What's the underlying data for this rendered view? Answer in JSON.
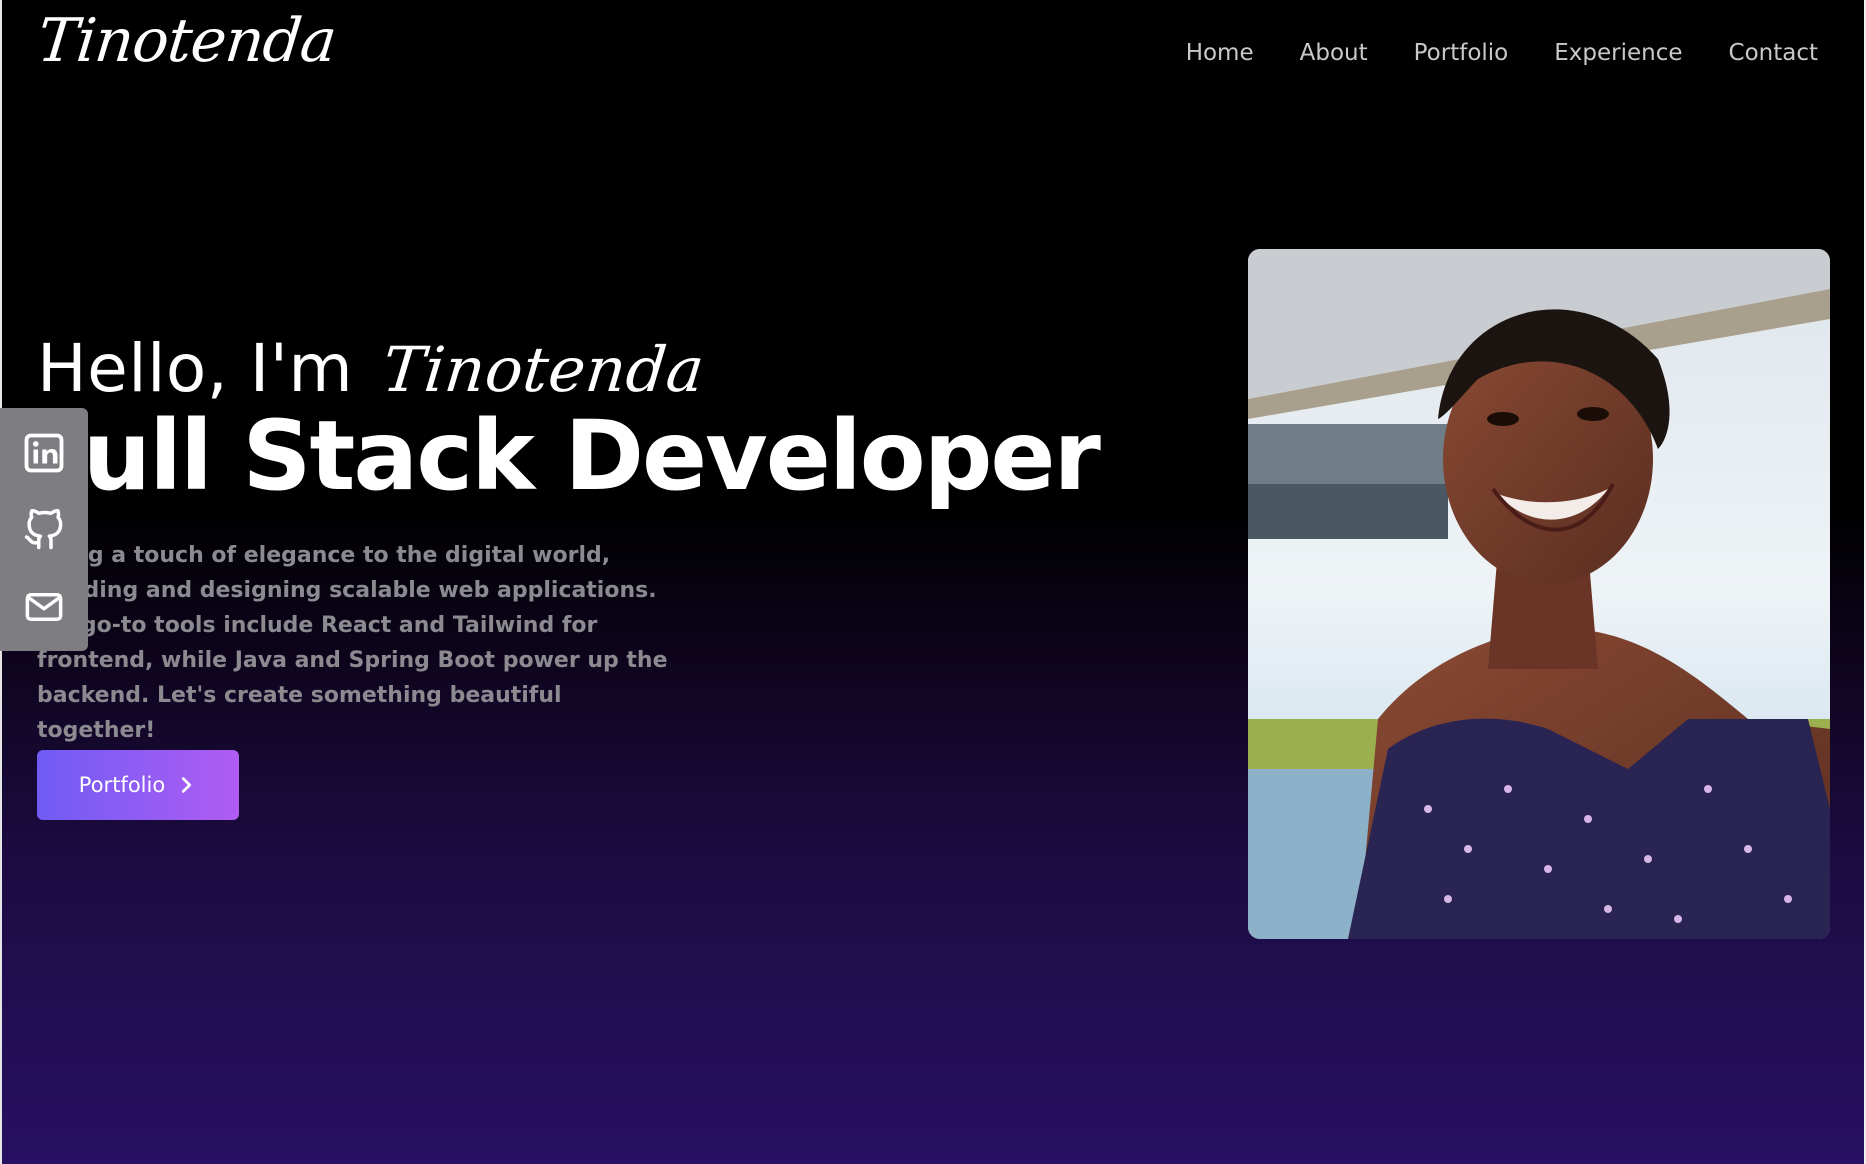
{
  "header": {
    "logo": "Tinotenda",
    "nav": [
      "Home",
      "About",
      "Portfolio",
      "Experience",
      "Contact"
    ]
  },
  "hero": {
    "greeting": "Hello, I'm",
    "name": "Tinotenda",
    "role": "Full Stack Developer",
    "description": "Bring a touch of elegance to the digital world, building and designing scalable web applications. My go-to tools include React and Tailwind for frontend, while Java and Spring Boot power up the backend. Let's create something beautiful together!",
    "button_label": "Portfolio",
    "button_icon": "chevron-right-icon"
  },
  "social": {
    "icons": [
      "linkedin-icon",
      "github-icon",
      "mail-icon"
    ]
  },
  "photo": {
    "subject": "profile-photo"
  },
  "colors": {
    "background_top": "#000000",
    "background_bottom": "#271062",
    "button_start": "#6f5cf5",
    "button_end": "#b05cf2",
    "social_bar": "#7d7d82",
    "nav_text": "#c9c9c9",
    "description_text": "#8b8a90"
  }
}
